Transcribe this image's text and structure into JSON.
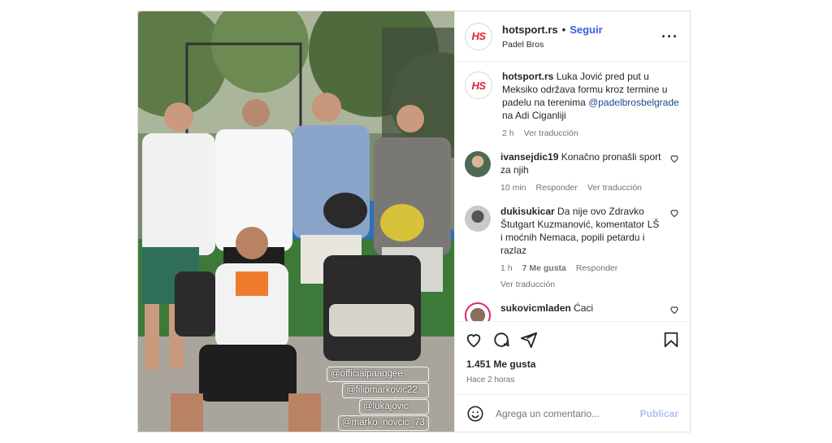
{
  "post": {
    "author": "hotsport.rs",
    "separator": "•",
    "follow_label": "Seguir",
    "location": "Padel Bros",
    "avatar_text": "HS",
    "more_icon": "more-horizontal-icon"
  },
  "photo": {
    "tags": [
      "@officialpaaggee",
      "@filipmarkovic22",
      "@lukajovic",
      "@marko_novcic_73"
    ]
  },
  "caption": {
    "author": "hotsport.rs",
    "text_1": "Luka Jović pred put u Meksiko održava formu kroz termine u padelu na terenima ",
    "mention": "@padelbrosbelgrade",
    "text_2": " na Adi Ciganliji",
    "time": "2 h",
    "translate": "Ver traducción"
  },
  "comments": [
    {
      "user": "ivansejdic19",
      "text": "Konačno pronašli sport za njih",
      "time": "10 min",
      "reply": "Responder",
      "translate": "Ver traducción"
    },
    {
      "user": "dukisukicar",
      "text": "Da nije ovo Zdravko Štutgart Kuzmanović, komentator LŠ i moćnih Nemaca, popili petardu i razlaz",
      "time": "1 h",
      "likes": "7 Me gusta",
      "reply": "Responder",
      "translate": "Ver traducción"
    },
    {
      "user": "sukovicmladen",
      "text": "Ćaci"
    }
  ],
  "actions": {
    "icons": [
      "heart-icon",
      "comment-icon",
      "share-icon",
      "bookmark-icon"
    ]
  },
  "likes": {
    "count": "1.451 Me gusta",
    "posted": "Hace 2 horas"
  },
  "add_comment": {
    "placeholder": "Agrega un comentario...",
    "publish_label": "Publicar"
  },
  "colors": {
    "accent": "#3a5fd9",
    "brand_red": "#e3223a",
    "muted": "#737373",
    "border": "#dbdbdb"
  }
}
